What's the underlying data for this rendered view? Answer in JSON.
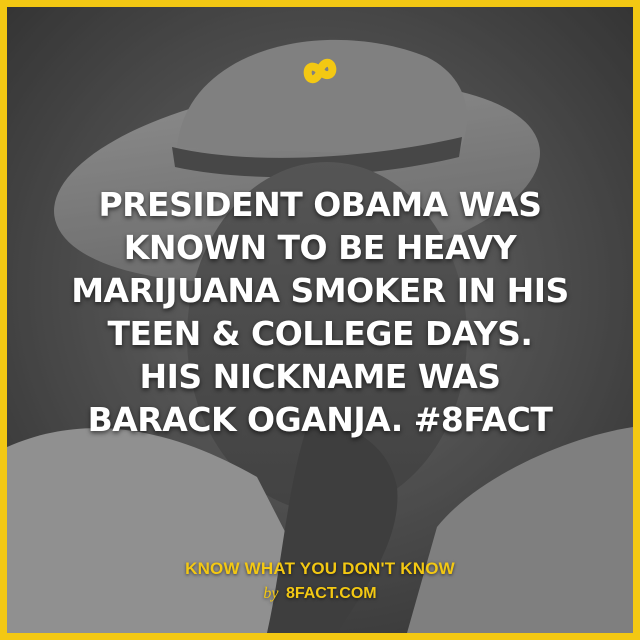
{
  "colors": {
    "brand_yellow": "#f3c813",
    "text_white": "#ffffff"
  },
  "logo": {
    "icon": "infinity-8-icon"
  },
  "fact": {
    "lines": [
      "PRESIDENT OBAMA WAS",
      "KNOWN TO BE HEAVY",
      "MARIJUANA SMOKER IN HIS",
      "TEEN & COLLEGE DAYS.",
      "HIS NICKNAME WAS",
      "BARACK OGANJA. #8FACT"
    ]
  },
  "footer": {
    "tagline": "KNOW WHAT YOU DON'T KNOW",
    "by_label": "by",
    "site": "8FACT.COM"
  }
}
